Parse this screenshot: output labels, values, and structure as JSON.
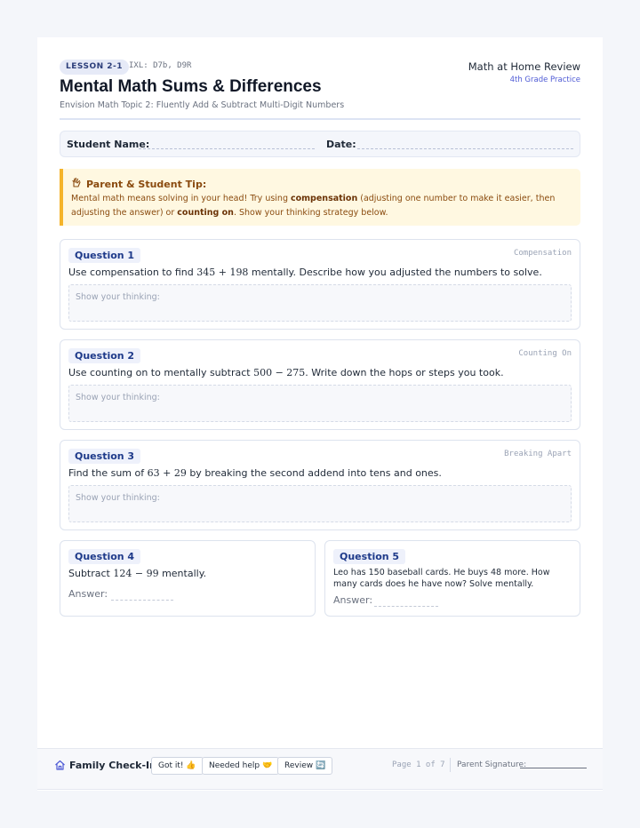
{
  "header": {
    "lesson": "LESSON 2-1",
    "ixl": "IXL: D7b, D9R",
    "title": "Mental Math Sums & Differences",
    "subtitle": "Envision Math Topic 2: Fluently Add & Subtract Multi-Digit Numbers",
    "brand": "Math at Home Review",
    "grade": "4th Grade Practice"
  },
  "student": {
    "name_label": "Student Name:",
    "date_label": "Date:"
  },
  "tip": {
    "heading": "Parent & Student Tip:",
    "body_1": "Mental math means solving in your head! Try using ",
    "bold_1": "compensation",
    "body_2": " (adjusting one number to make it easier, then adjusting the answer) or ",
    "bold_2": "counting on",
    "body_3": ". Show your thinking strategy below."
  },
  "questions": [
    {
      "label": "Question 1",
      "strategy": "Compensation",
      "pre": "Use compensation to find ",
      "math": "345 + 198",
      "post": " mentally. Describe how you adjusted the numbers to solve.",
      "placeholder": "Show your thinking:"
    },
    {
      "label": "Question 2",
      "strategy": "Counting On",
      "pre": "Use counting on to mentally subtract ",
      "math": "500 − 275",
      "post": ". Write down the hops or steps you took.",
      "placeholder": "Show your thinking:"
    },
    {
      "label": "Question 3",
      "strategy": "Breaking Apart",
      "pre": "Find the sum of ",
      "math": "63 + 29",
      "post": " by breaking the second addend into tens and ones.",
      "placeholder": "Show your thinking:"
    },
    {
      "label": "Question 4",
      "pre": "Subtract ",
      "math": "124 − 99",
      "post": " mentally.",
      "answer_label": "Answer:"
    },
    {
      "label": "Question 5",
      "text": "Leo has 150 baseball cards. He buys 48 more. How many cards does he have now? Solve mentally.",
      "answer_label": "Answer:"
    }
  ],
  "footer": {
    "family_checkin": "Family Check-In:",
    "chips": [
      "Got it! 👍",
      "Needed help 🤝",
      "Review 🔄"
    ],
    "page": "Page 1 of 7",
    "signature_label": "Parent Signature:"
  },
  "colors": {
    "accent": "#4f5bd5",
    "tip_bg": "#fff8e1",
    "tip_border": "#f5b42a",
    "badge_bg": "#eef1fb"
  }
}
